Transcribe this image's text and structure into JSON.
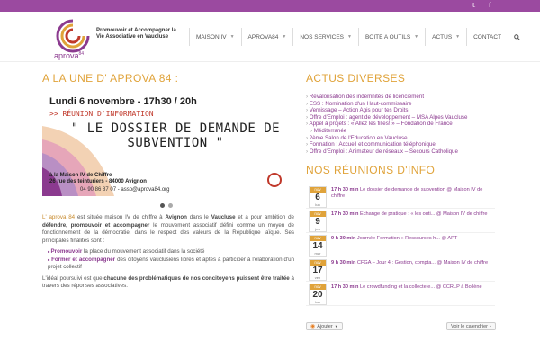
{
  "topbar": {
    "social": [
      {
        "name": "twitter-icon",
        "glyph": "𝕥"
      },
      {
        "name": "facebook-icon",
        "glyph": "f"
      }
    ]
  },
  "brand": {
    "logo_text": "aprova",
    "logo_num": "84",
    "tagline": "Promouvoir et Accompagner la Vie Associative en Vaucluse"
  },
  "nav": {
    "items": [
      {
        "label": "MAISON IV",
        "has_menu": true
      },
      {
        "label": "APROVA84",
        "has_menu": true
      },
      {
        "label": "NOS SERVICES",
        "has_menu": true
      },
      {
        "label": "BOITE A OUTILS",
        "has_menu": true
      },
      {
        "label": "ACTUS",
        "has_menu": true
      },
      {
        "label": "CONTACT",
        "has_menu": false
      }
    ],
    "search_icon": "search-icon"
  },
  "main": {
    "heading": "A LA UNE D' APROVA 84 :",
    "slide": {
      "date": "Lundi 6 novembre - 17h30 / 20h",
      "sub": ">> RÉUNION D'INFORMATION",
      "title": "\" LE DOSSIER DE DEMANDE DE SUBVENTION \"",
      "address_1": "à la Maison IV de Chiffre",
      "address_2": "26 rue des teinturiers - 84000 Avignon",
      "contact": "04 90 86 87 07 - asso@aprova84.org"
    },
    "intro": {
      "p1_brand": "L' aprova 84",
      "p1_a": " est située maison IV de chiffre à ",
      "p1_b": "Avignon",
      "p1_c": " dans le ",
      "p1_d": "Vaucluse",
      "p1_e": " et a pour ambition de ",
      "p1_f": "défendre, promouvoir et accompagner",
      "p1_g": " le mouvement associatif défini comme un moyen de fonctionnement de la démocratie, dans le respect des valeurs de la République laïque. Ses principales finalités sont :",
      "li1_hl": "Promouvoir",
      "li1_rest": " la place du mouvement associatif dans la société",
      "li2_hl": "Former et accompagner",
      "li2_rest": " des citoyens vauclusiens libres et aptes à participer à l'élaboration d'un projet collectif",
      "p2_a": "L'idéal poursuivi est que ",
      "p2_b": "chacune des problématiques de nos concitoyens puissent être traitée",
      "p2_c": " à travers des réponses associatives."
    }
  },
  "sidebar": {
    "news_heading": "ACTUS DIVERSES",
    "news": [
      "Revalorisation des indemnités de licenciement",
      "ESS : Nomination d'un Haut-commissaire",
      "Vernissage – Action Agis pour tes Droits",
      "Offre d'Emploi : agent de développement – MSA Alpes Vaucluse",
      "Appel à projets : « Allez les filles! » – Fondation de France",
      "Méditerranée",
      "2ème Salon de l'Education en Vaucluse",
      "Formation : Accueil et communication téléphonique",
      "Offre d'Emploi : Animateur de réseaux – Secours Catholique"
    ],
    "events_heading": "NOS RÉUNIONS D'INFO",
    "events": [
      {
        "month": "nov",
        "day": "6",
        "weekday": "lun",
        "time": "17 h 30 min",
        "text": " Le dossier de demande de subvention @ Maison IV de chiffre"
      },
      {
        "month": "nov",
        "day": "9",
        "weekday": "jeu",
        "time": "17 h 30 min",
        "text": " Echange de pratique : « les outi... @ Maison IV de chiffre"
      },
      {
        "month": "nov",
        "day": "14",
        "weekday": "mar",
        "time": "9 h 30 min",
        "text": " Journée Formation « Ressources h... @ APT"
      },
      {
        "month": "nov",
        "day": "17",
        "weekday": "ven",
        "time": "9 h 30 min",
        "text": " CFGA – Jour 4 : Gestion, compta... @ Maison IV de chiffre"
      },
      {
        "month": "nov",
        "day": "20",
        "weekday": "lun",
        "time": "17 h 30 min",
        "text": " Le crowdfunding et la collecte e... @ CCRLP à Bollène"
      }
    ],
    "add_label": "Ajouter",
    "view_label": "Voir le calendrier"
  },
  "colors": {
    "purple": "#9b4aa0",
    "accent": "#e0a33a",
    "link": "#8b3a8f"
  }
}
